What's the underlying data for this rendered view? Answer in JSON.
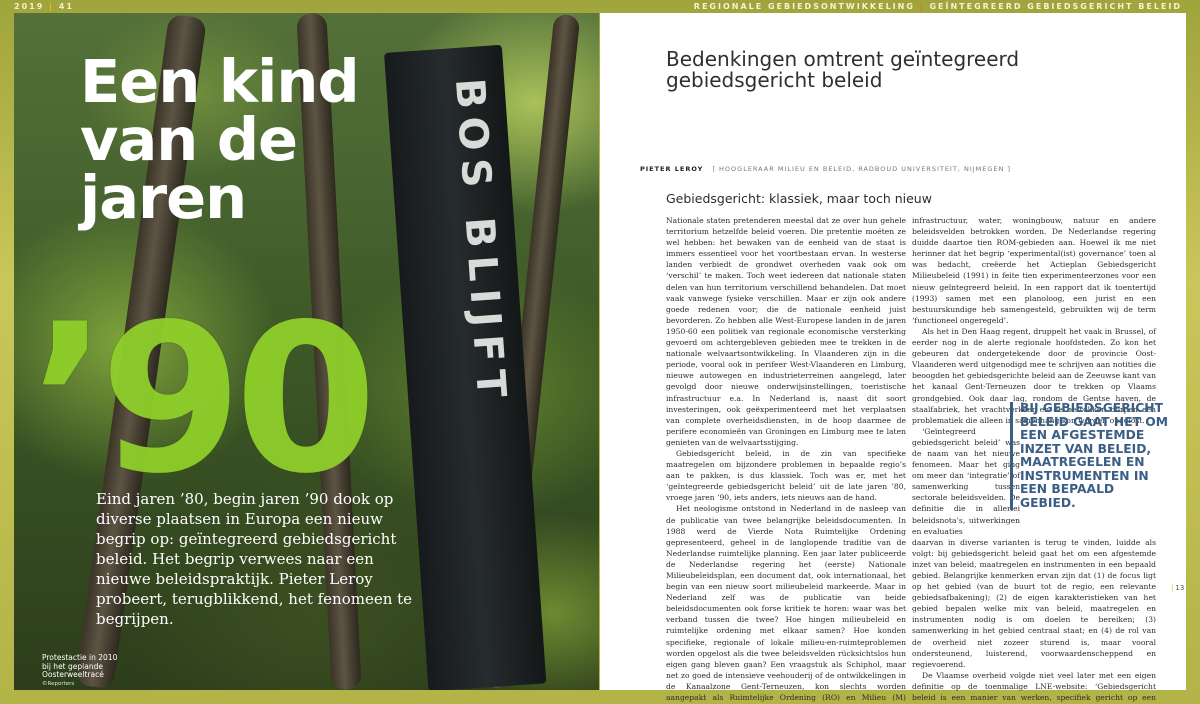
{
  "header": {
    "folio_left": "2019",
    "issue_no": "41",
    "section_label": "REGIONALE GEBIEDSONTWIKKELING",
    "section_topic": "GEÏNTEGREERD GEBIEDSGERICHT BELEID"
  },
  "left_page": {
    "headline": "Een kind van de jaren",
    "big_number": "’90",
    "banner_text": "BOS BLIJFT",
    "lede": "Eind jaren ’80, begin jaren ’90 dook op diverse plaatsen in Europa een nieuw begrip op: geïntegreerd gebiedsgericht beleid. Het begrip verwees naar een nieuwe beleidspraktijk. Pieter Leroy probeert, terugblikkend, het fenomeen te begrijpen.",
    "caption": "Protestactie in 2010 bij het geplande Oosterweeltracé",
    "caption_credit": "©Reporters"
  },
  "right_page": {
    "title": "Bedenkingen omtrent geïntegreerd gebiedsgericht beleid",
    "author": "PIETER LEROY",
    "affiliation": "[ HOOGLERAAR MILIEU EN BELEID, RADBOUD UNIVERSITEIT, NIJMEGEN ]",
    "section_head": "Gebiedsgericht: klassiek, maar toch nieuw",
    "col1": [
      "Nationale staten pretenderen meestal dat ze over hun gehele territorium hetzelfde beleid voeren. Die pretentie moéten ze wel hebben: het bewaken van de eenheid van de staat is immers essentieel voor het voortbestaan ervan. In westerse landen verbiedt de grondwet overheden vaak ook om ‘verschil’ te maken. Toch weet iedereen dat nationale staten delen van hun territorium verschillend behandelen. Dat moet vaak vanwege fysieke verschillen. Maar er zijn ook andere goede redenen voor; die de nationale eenheid juist bevorderen. Zo hebben alle West-Europese landen in de jaren 1950-60 een politiek van regionale economische versterking gevoerd om achtergebleven gebieden mee te trekken in de nationale welvaartsontwikkeling. In Vlaanderen zijn in die periode, vooral ook in perifeer West-Vlaanderen en Limburg, nieuwe autowegen en industrieterreinen aangelegd, later gevolgd door nieuwe onderwijsinstellingen, toeristische infrastructuur e.a. In Nederland is, naast dit soort investeringen, ook geëxperimenteerd met het verplaatsen van complete overheidsdiensten, in de hoop daarmee de perifere economieën van Groningen en Limburg mee te laten genieten van de welvaartsstijging.",
      "Gebiedsgericht beleid, in de zin van specifieke maatregelen om bijzondere problemen in bepaalde regio’s aan te pakken, is dus klassiek. Toch was er, met het ‘geïntegreerde gebiedsgericht beleid’ uit de late jaren ’80, vroege jaren ’90, iets anders, iets nieuws aan de hand.",
      "Het neologisme ontstond in Nederland in de nasleep van de publicatie van twee belangrijke beleidsdocumenten. In 1988 werd de Vierde Nota Ruimtelijke Ordening gepresenteerd, geheel in de langlopende traditie van de Nederlandse ruimtelijke planning. Een jaar later publiceerde de Nederlandse regering het (eerste) Nationale Milieubeleidsplan, een document dat, ook internationaal, het begin van een nieuw soort milieubeleid markeerde. Maar in Nederland zelf was de publicatie van beide beleidsdocumenten ook forse kritiek te horen: waar was het verband tussen die twee? Hoe hingen milieubeleid en ruimtelijke ordening met elkaar samen? Hoe konden specifieke, regionale of lokale milieu-en-ruimteproblemen worden opgelost als die twee beleidsvelden rücksichtslos hun eigen gang bleven gaan? Een vraagstuk als Schiphol, maar net zo goed de intensieve veehouderij of de ontwikkelingen in de Kanaalzone Gent-Terneuzen, kon slechts worden aangepakt als Ruimtelijke Ordening (RO) en Milieu (M) samen zouden werken. Daarnaast moesten, naargelang het specifieke probleem en dito gebied, ook"
    ],
    "col2_top": "infrastructuur, water, woningbouw, natuur en andere beleidsvelden betrokken worden. De Nederlandse regering duidde daartoe tien ROM-gebieden aan. Hoewel ik me niet herinner dat het begrip ‘experimental(ist) governance’ toen al was bedacht, creëerde het Actieplan Gebiedsgericht Milieubeleid (1991) in feite tien experimenteerzones voor een nieuw geïntegreerd beleid. In een rapport dat ik toentertijd (1993) samen met een planoloog, een jurist en een bestuurskundige heb samengesteld, gebruikten wij de term ‘functioneel ongeregeld’.",
    "col2_p2": "Als het in Den Haag regent, druppelt het vaak in Brussel, of eerder nog in de alerte regionale hoofdsteden. Zo kon het gebeuren dat ondergetekende door de provincie Oost-Vlaanderen werd uitgenodigd mee te schrijven aan notities die beoogden het gebiedsgerichte beleid aan de Zeeuwse kant van het kanaal Gent-Terneuzen door te trekken op Vlaams grondgebied. Ook daar lag, rondom de Gentse haven, de staalfabriek, het vrachtverkeer en de betrokken dorpen een problematiek die alleen in samenhang kon worden opgelost.",
    "col2_p3": "‘Geïntegreerd gebiedsgericht beleid’ was de naam van het nieuwe fenomeen. Maar het ging om meer dan ‘integratie’ of samenwerking tussen sectorale beleidsvelden. De definitie die in allerlei beleidsnota’s, uitwerkingen en evaluaties",
    "col2_p3_cont": "daarvan in diverse varianten is terug te vinden, luidde als volgt: bij gebiedsgericht beleid gaat het om een afgestemde inzet van beleid, maatregelen en instrumenten in een bepaald gebied. Belangrijke kenmerken ervan zijn dat (1) de focus ligt op het gebied (van de buurt tot de regio, een relevante gebiedsafbakening); (2) de eigen karakteristieken van het gebied bepalen welke mix van beleid, maatregelen en instrumenten nodig is om doelen te bereiken; (3) samenwerking in het gebied centraal staat; en (4) de rol van de overheid niet zozeer sturend is, maar vooral ondersteunend, luisterend, voorwaardenscheppend en regievoerend.",
    "col2_p4": "De Vlaamse overheid volgde niet veel later met een eigen definitie op de toenmalige LNE-website: ‘Gebiedsgericht beleid is een manier van werken, specifiek gericht op een bepaald gebied",
    "pullquote": "Bij gebiedsgericht beleid gaat het om een afgestemde inzet van beleid, maatregelen en instrumenten in een bepaald gebied.",
    "page_number": "13"
  },
  "colors": {
    "accent_green": "#8fcf2a",
    "pullquote_blue": "#3a5e86",
    "folio_yellow": "#e7b838"
  }
}
